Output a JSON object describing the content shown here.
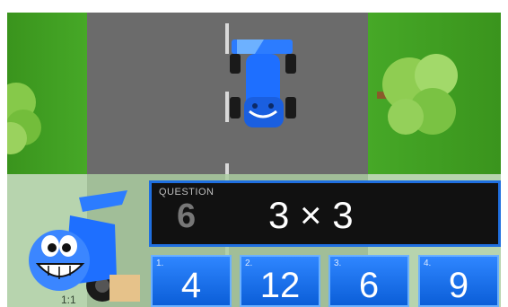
{
  "question": {
    "label": "QUESTION",
    "number": "6",
    "text": "3 × 3"
  },
  "answers": [
    {
      "index": "1.",
      "value": "4"
    },
    {
      "index": "2.",
      "value": "12"
    },
    {
      "index": "3.",
      "value": "6"
    },
    {
      "index": "4.",
      "value": "9"
    }
  ],
  "hint_text": "1:1",
  "colors": {
    "grass": "#3f9e21",
    "road": "#6b6b6b",
    "car_blue": "#1e6fff",
    "panel": "#111111",
    "panel_border": "#1f6fe0",
    "answer_button": "#0b5ed8"
  },
  "icons": {
    "opponent_car": "blue-racecar-icon",
    "player_car": "blue-racecar-mascot-icon",
    "tree": "tree-icon"
  }
}
